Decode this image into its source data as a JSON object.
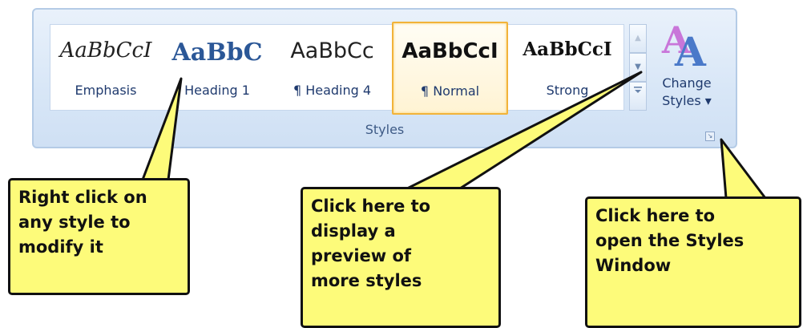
{
  "styles_gallery": {
    "items": [
      {
        "preview": "AaBbCcI",
        "name": "Emphasis"
      },
      {
        "preview": "AaBbC",
        "name": "Heading 1"
      },
      {
        "preview": "AaBbCc",
        "name": "¶ Heading 4"
      },
      {
        "preview": "AaBbCcI",
        "name": "¶ Normal",
        "selected": true
      },
      {
        "preview": "AaBbCcI",
        "name": "Strong"
      }
    ],
    "scroll_up_icon": "triangle-up",
    "scroll_down_icon": "triangle-down",
    "more_icon": "more-arrow"
  },
  "change_styles": {
    "line1": "Change",
    "line2": "Styles ▾",
    "icon": "change-styles-icon"
  },
  "group_label": "Styles",
  "launcher_icon": "dialog-launcher",
  "callouts": {
    "right_click": "Right click on\nany style to\nmodify it",
    "preview": "Click here to\ndisplay a\npreview of\nmore styles",
    "window": "Click here to\nopen the Styles\nWindow"
  },
  "colors": {
    "callout_fill": "#fdfb7a",
    "selected_border": "#f2b33a",
    "ribbon": "#d9e7f7"
  }
}
